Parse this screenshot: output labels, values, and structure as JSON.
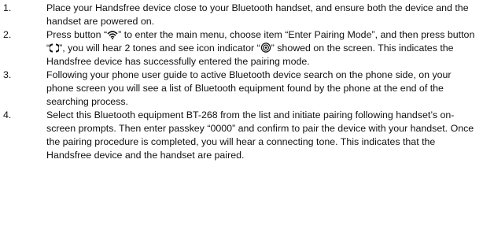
{
  "steps": [
    {
      "number": "1.",
      "text": "Place your Handsfree device close to your Bluetooth handset, and ensure both the device and the handset are powered on."
    },
    {
      "number": "2.",
      "part1": "Press button “",
      "icon1": "wifi-menu-icon",
      "part2": "” to enter the main menu, choose item “Enter Pairing Mode”, and then press button “",
      "icon2": "circle-brackets-icon",
      "part3": "”, you will hear 2 tones and see icon indicator “",
      "icon3": "pairing-indicator-icon",
      "part4": "” showed on the screen. This indicates the Handsfree device has successfully entered the pairing mode."
    },
    {
      "number": "3.",
      "text": "Following your phone user guide to active Bluetooth device search on the phone side, on your phone screen you will see a list of Bluetooth equipment found by the phone at the end of the searching process."
    },
    {
      "number": "4.",
      "text": "Select this Bluetooth equipment BT-268 from the list and initiate pairing following handset’s on-screen prompts. Then enter passkey “0000” and confirm to pair the device with your handset. Once the pairing procedure is completed, you will hear a connecting tone. This indicates that the Handsfree device and the handset are paired."
    }
  ]
}
